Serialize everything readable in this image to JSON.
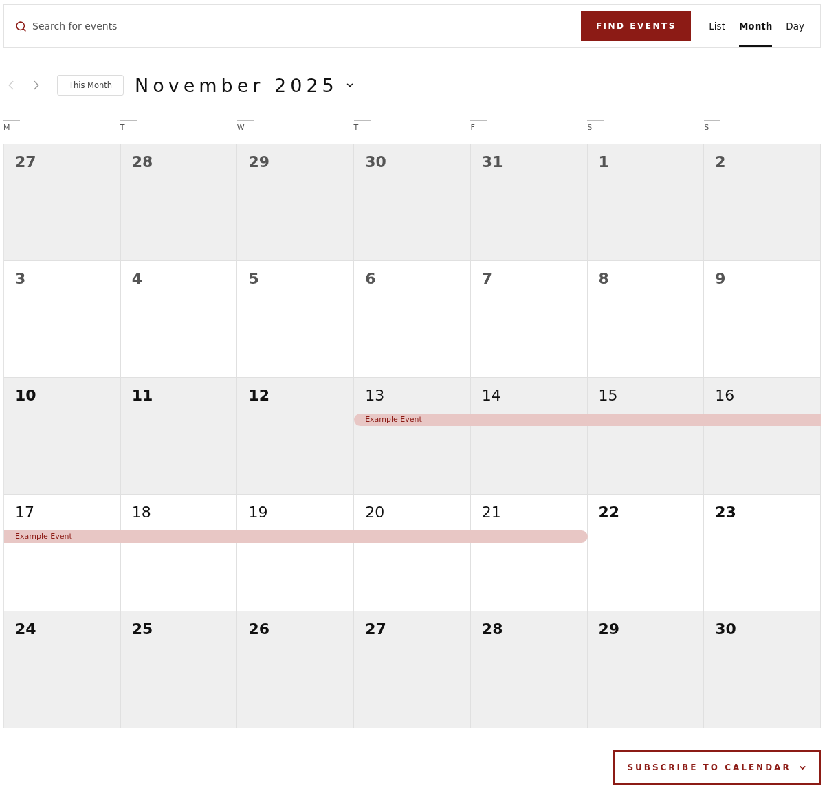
{
  "search": {
    "placeholder": "Search for events",
    "button": "FIND EVENTS"
  },
  "views": [
    {
      "label": "List",
      "selected": false
    },
    {
      "label": "Month",
      "selected": true
    },
    {
      "label": "Day",
      "selected": false
    }
  ],
  "nav": {
    "prev": {
      "disabled": true
    },
    "next": {
      "disabled": false
    },
    "today_button": "This Month",
    "title": "November 2025"
  },
  "weekdays": [
    "M",
    "T",
    "W",
    "T",
    "F",
    "S",
    "S"
  ],
  "weeks": [
    {
      "shaded": true,
      "days": [
        {
          "label": "27",
          "past": true,
          "in_event": false
        },
        {
          "label": "28",
          "past": true,
          "in_event": false
        },
        {
          "label": "29",
          "past": true,
          "in_event": false
        },
        {
          "label": "30",
          "past": true,
          "in_event": false
        },
        {
          "label": "31",
          "past": true,
          "in_event": false
        },
        {
          "label": "1",
          "past": true,
          "in_event": false
        },
        {
          "label": "2",
          "past": true,
          "in_event": false
        }
      ]
    },
    {
      "shaded": false,
      "days": [
        {
          "label": "3",
          "past": true,
          "in_event": false
        },
        {
          "label": "4",
          "past": true,
          "in_event": false
        },
        {
          "label": "5",
          "past": true,
          "in_event": false
        },
        {
          "label": "6",
          "past": true,
          "in_event": false
        },
        {
          "label": "7",
          "past": true,
          "in_event": false
        },
        {
          "label": "8",
          "past": true,
          "in_event": false
        },
        {
          "label": "9",
          "past": true,
          "in_event": false
        }
      ]
    },
    {
      "shaded": true,
      "event": {
        "title": "Example Event",
        "starts": true,
        "ends": false
      },
      "days": [
        {
          "label": "10",
          "past": false,
          "in_event": false
        },
        {
          "label": "11",
          "past": false,
          "in_event": false
        },
        {
          "label": "12",
          "past": false,
          "in_event": false
        },
        {
          "label": "13",
          "past": false,
          "in_event": true
        },
        {
          "label": "14",
          "past": false,
          "in_event": true
        },
        {
          "label": "15",
          "past": false,
          "in_event": true
        },
        {
          "label": "16",
          "past": false,
          "in_event": true
        }
      ]
    },
    {
      "shaded": false,
      "event": {
        "title": "Example Event",
        "starts": false,
        "ends": true
      },
      "days": [
        {
          "label": "17",
          "past": false,
          "in_event": true
        },
        {
          "label": "18",
          "past": false,
          "in_event": true
        },
        {
          "label": "19",
          "past": false,
          "in_event": true
        },
        {
          "label": "20",
          "past": false,
          "in_event": true
        },
        {
          "label": "21",
          "past": false,
          "in_event": true
        },
        {
          "label": "22",
          "past": false,
          "in_event": false
        },
        {
          "label": "23",
          "past": false,
          "in_event": false
        }
      ]
    },
    {
      "shaded": true,
      "days": [
        {
          "label": "24",
          "past": false,
          "in_event": false
        },
        {
          "label": "25",
          "past": false,
          "in_event": false
        },
        {
          "label": "26",
          "past": false,
          "in_event": false
        },
        {
          "label": "27",
          "past": false,
          "in_event": false
        },
        {
          "label": "28",
          "past": false,
          "in_event": false
        },
        {
          "label": "29",
          "past": false,
          "in_event": false
        },
        {
          "label": "30",
          "past": false,
          "in_event": false
        }
      ]
    }
  ],
  "subscribe": "SUBSCRIBE TO CALENDAR"
}
